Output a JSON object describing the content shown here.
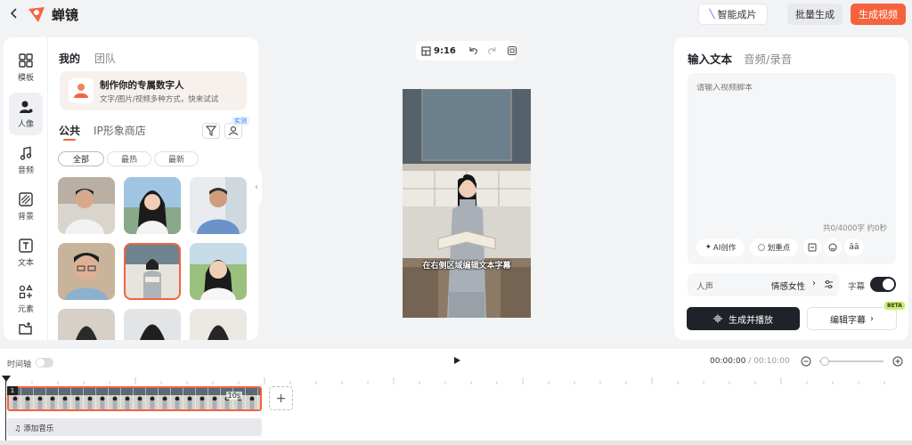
{
  "app": {
    "brand": "蝉镜"
  },
  "topbar": {
    "smart_label": "智能成片",
    "batch_label": "批量生成",
    "generate_label": "生成视频"
  },
  "colors": {
    "accent": "#f4633d",
    "dark": "#1f2329",
    "beta": "#c9f06b"
  },
  "sidebar": {
    "items": [
      {
        "label": "模板",
        "icon": "template-icon"
      },
      {
        "label": "人像",
        "icon": "person-icon",
        "active": true
      },
      {
        "label": "音频",
        "icon": "music-icon"
      },
      {
        "label": "背景",
        "icon": "background-icon"
      },
      {
        "label": "文本",
        "icon": "text-icon"
      },
      {
        "label": "元素",
        "icon": "element-icon"
      },
      {
        "label": "",
        "icon": "folder-icon"
      }
    ]
  },
  "left": {
    "tabs": [
      "我的",
      "团队"
    ],
    "promo_title": "制作你的专属数字人",
    "promo_sub": "文字/图片/视频多种方式，快来试试",
    "sub_tabs": [
      "公共",
      "IP形象商店"
    ],
    "badge": "实测",
    "filters": [
      "全部",
      "最热",
      "最新"
    ]
  },
  "center": {
    "ratio": "9:16",
    "subtitle": "在右侧区域编辑文本字幕"
  },
  "right": {
    "tabs": [
      "输入文本",
      "音频/录音"
    ],
    "script_placeholder": "请输入视频脚本",
    "char_count": "共0/4000字 约0秒",
    "tools": {
      "ai": "AI创作",
      "highlight": "划重点",
      "aa": "āā"
    },
    "voice_label": "人声",
    "voice_value": "情感女性",
    "subtitle_label": "字幕",
    "subtitle_on": true,
    "play_label": "生成并播放",
    "edit_label": "编辑字幕",
    "beta": "BETA"
  },
  "timeline": {
    "label": "时间轴",
    "time_current": "00:00:00",
    "time_total": "/ 00:10:00",
    "track_no": "1",
    "clip_duration": "10s",
    "music_label": "添加音乐"
  }
}
